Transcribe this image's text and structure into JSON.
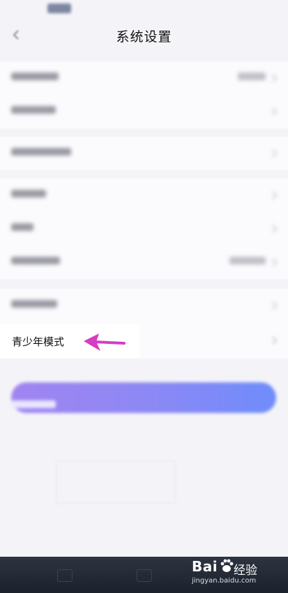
{
  "header": {
    "title": "系统设置"
  },
  "rows": {
    "teen_mode_label": "青少年模式"
  },
  "colors": {
    "arrow": "#d63cc4",
    "logout_gradient_start": "#a184f0",
    "logout_gradient_end": "#6f8cfb"
  },
  "watermark": {
    "brand": "Bai",
    "brand_suffix": "经验",
    "url": "jingyan.baidu.com"
  },
  "icons": [
    "back-icon",
    "chevron-right-icon",
    "pointer-arrow-icon",
    "baidu-paw-icon"
  ]
}
